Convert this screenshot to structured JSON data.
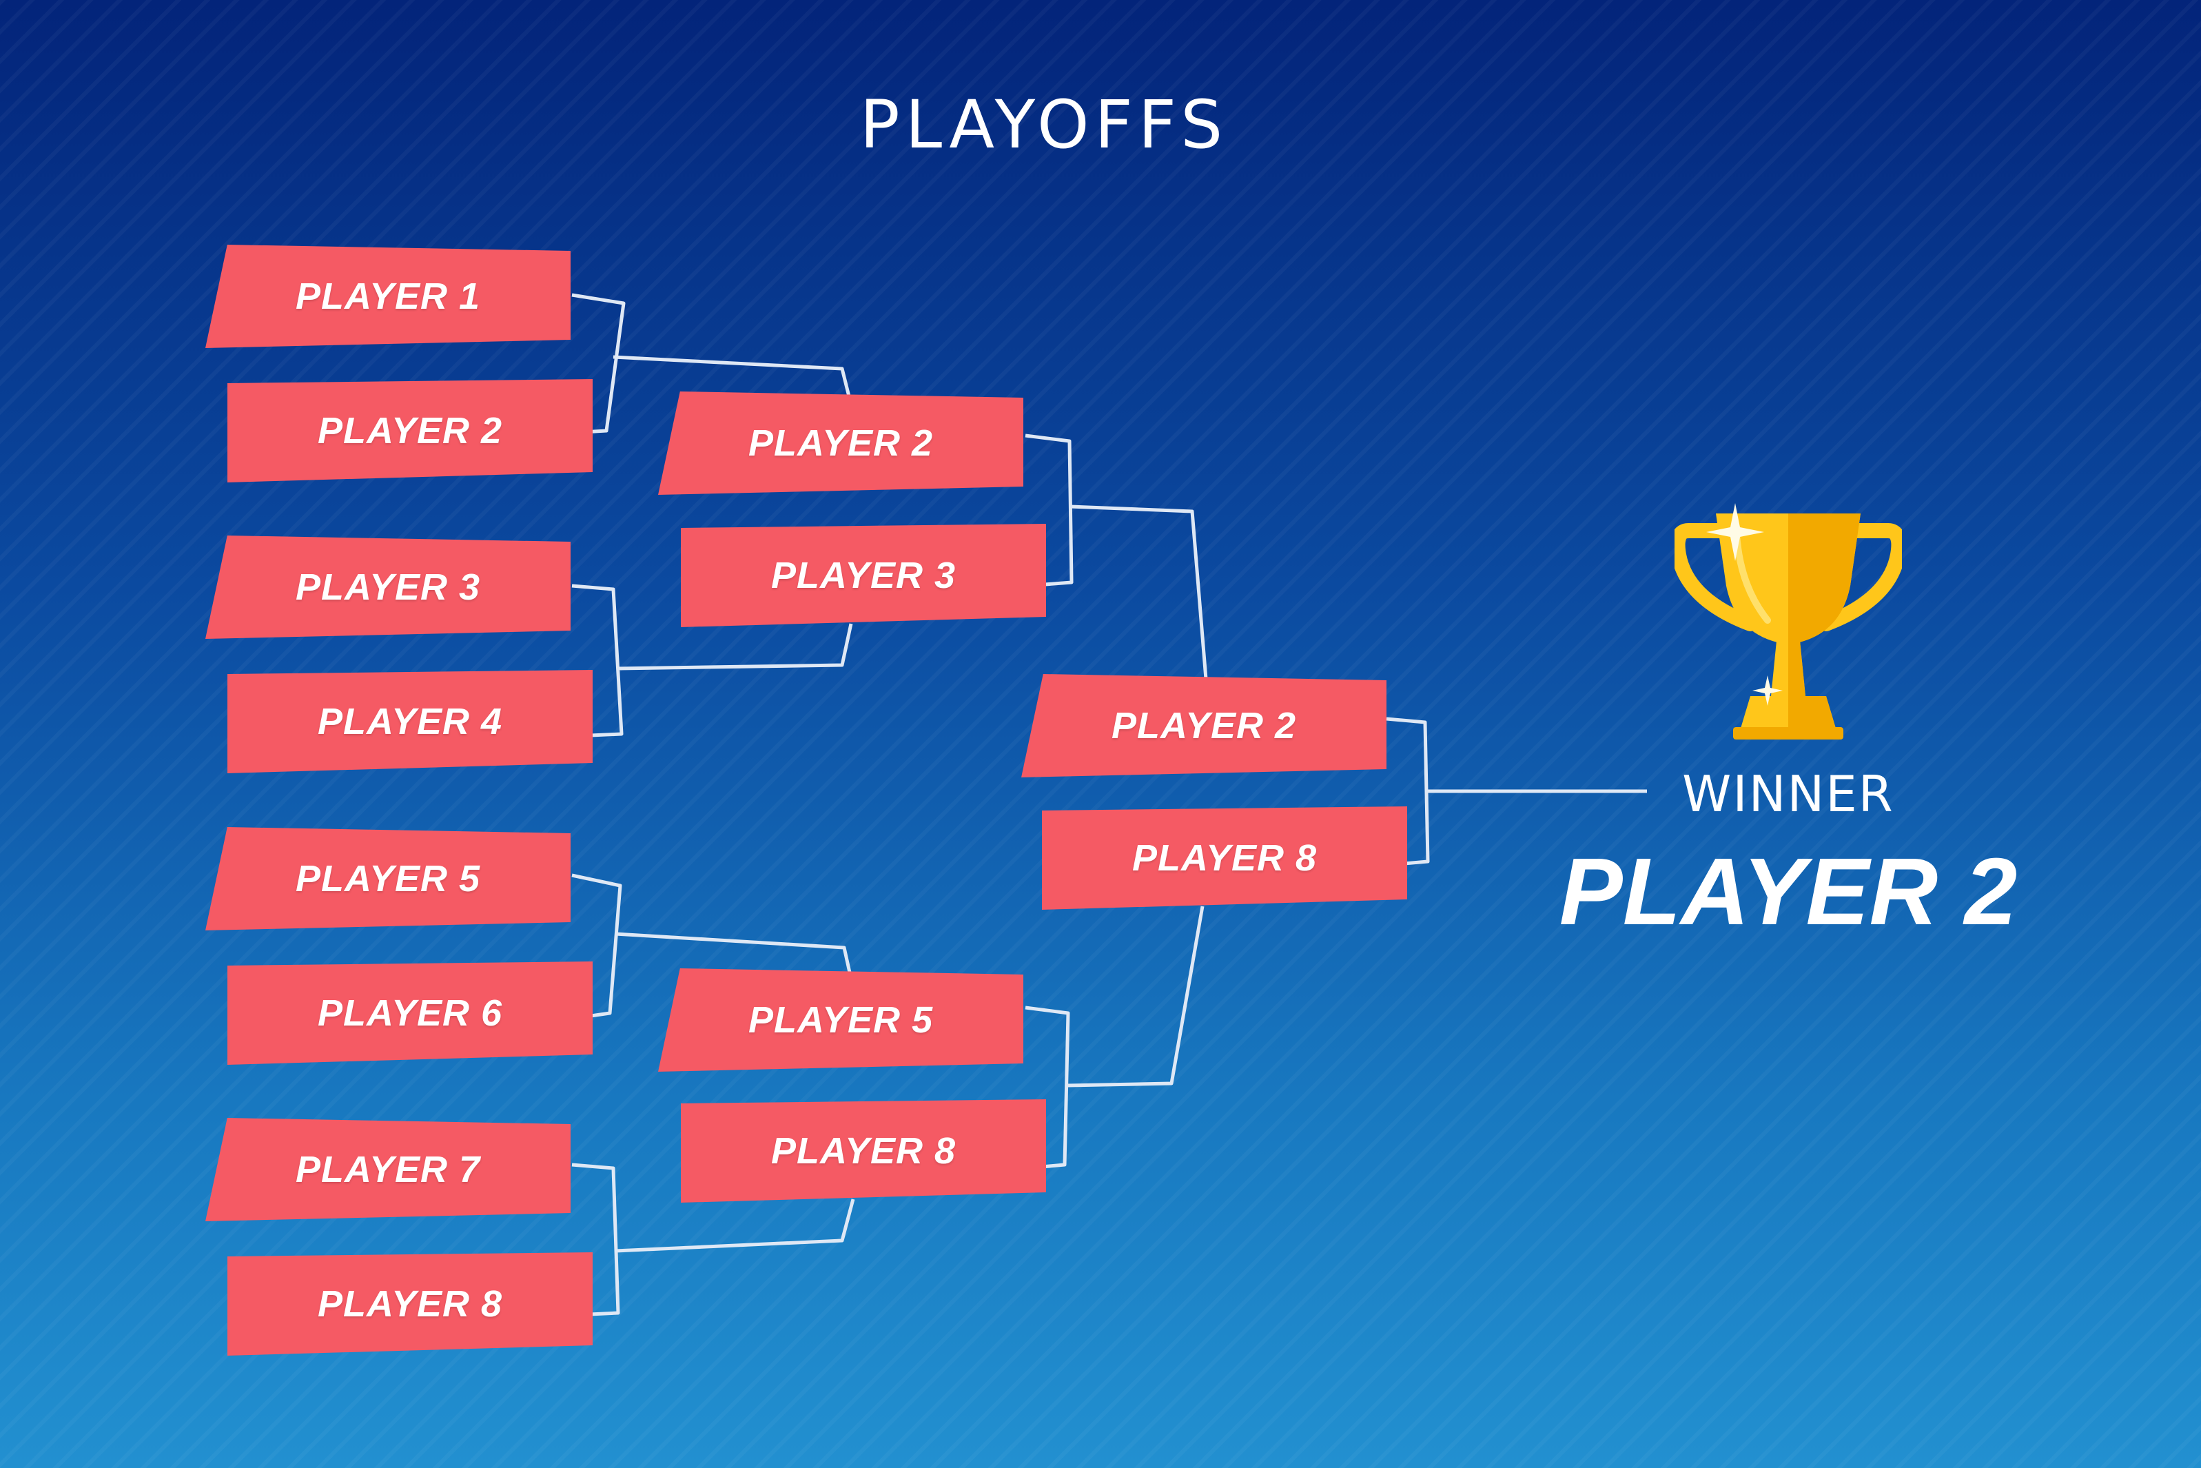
{
  "title": "PLAYOFFS",
  "colors": {
    "slot_fill": "#f55a64",
    "connector": "#dfe8f5",
    "trophy_gold": "#ffc61a",
    "background_top": "#03247a",
    "background_bottom": "#2290d0"
  },
  "rounds": [
    {
      "slots": [
        "PLAYER 1",
        "PLAYER 2",
        "PLAYER 3",
        "PLAYER 4",
        "PLAYER 5",
        "PLAYER 6",
        "PLAYER 7",
        "PLAYER 8"
      ]
    },
    {
      "slots": [
        "PLAYER 2",
        "PLAYER 3",
        "PLAYER 5",
        "PLAYER 8"
      ]
    },
    {
      "slots": [
        "PLAYER 2",
        "PLAYER 8"
      ]
    }
  ],
  "winner": {
    "label": "WINNER",
    "name": "PLAYER 2",
    "icon": "trophy-icon"
  }
}
